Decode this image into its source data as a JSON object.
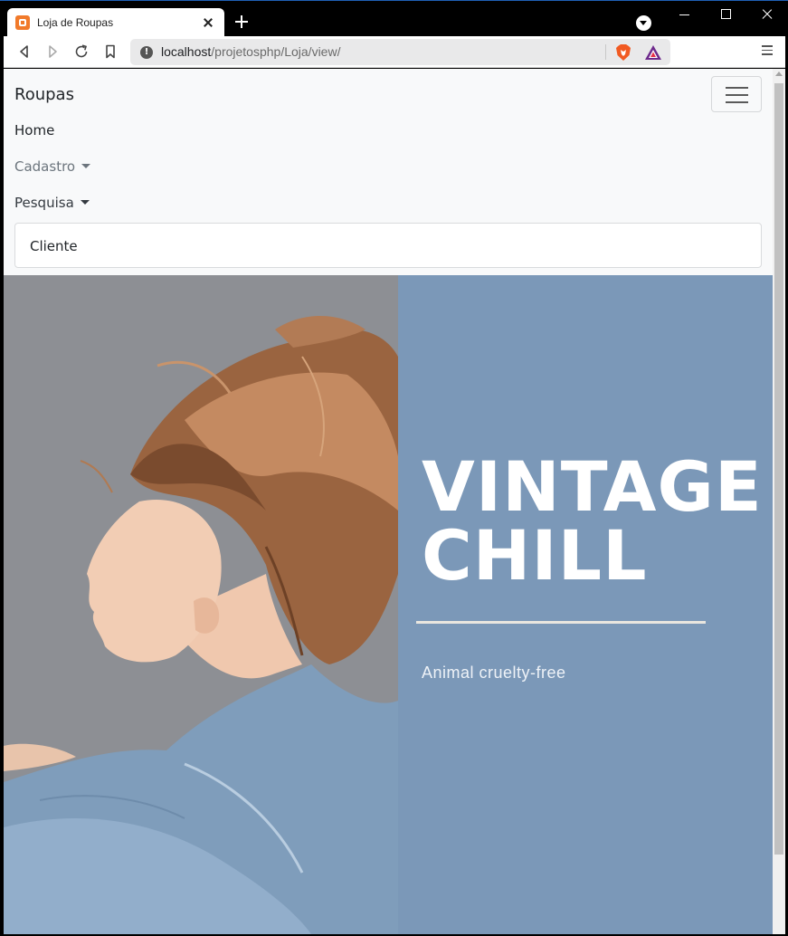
{
  "browser": {
    "tab": {
      "title": "Loja de Roupas",
      "favicon": "xampp-icon"
    },
    "address": {
      "host": "localhost",
      "path": "/projetosphp/Loja/view/"
    },
    "icons": [
      "back-icon",
      "forward-icon",
      "reload-icon",
      "bookmark-icon",
      "site-info-icon",
      "brave-shields-icon",
      "brave-rewards-icon",
      "menu-icon"
    ]
  },
  "navbar": {
    "brand": "Roupas",
    "links": {
      "home": "Home",
      "cadastro": "Cadastro",
      "pesquisa": "Pesquisa"
    },
    "dropdown": {
      "items": [
        "Cliente"
      ]
    }
  },
  "banner": {
    "headline_line1": "VINTAGE",
    "headline_line2": "CHILL",
    "tagline": "Animal cruelty-free",
    "colors": {
      "panel": "#7b98b8",
      "rule": "#e9e6df"
    }
  }
}
